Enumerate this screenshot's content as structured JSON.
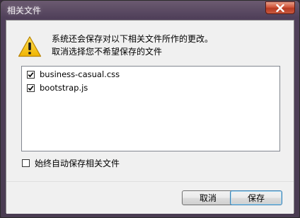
{
  "window": {
    "title": "相关文件",
    "close_glyph": "×"
  },
  "message": {
    "icon": "warning-icon",
    "line1": "系统还会保存对以下相关文件所作的更改。",
    "line2": "取消选择您不希望保存的文件"
  },
  "files": [
    {
      "name": "business-casual.css",
      "checked": true
    },
    {
      "name": "bootstrap.js",
      "checked": true
    }
  ],
  "always_save": {
    "label": "始终自动保存相关文件",
    "checked": false
  },
  "buttons": {
    "cancel": "取消",
    "save": "保存"
  },
  "colors": {
    "close_button": "#c9462c",
    "warning_fill": "#f5c400",
    "default_button_border": "#3c7fb1"
  }
}
